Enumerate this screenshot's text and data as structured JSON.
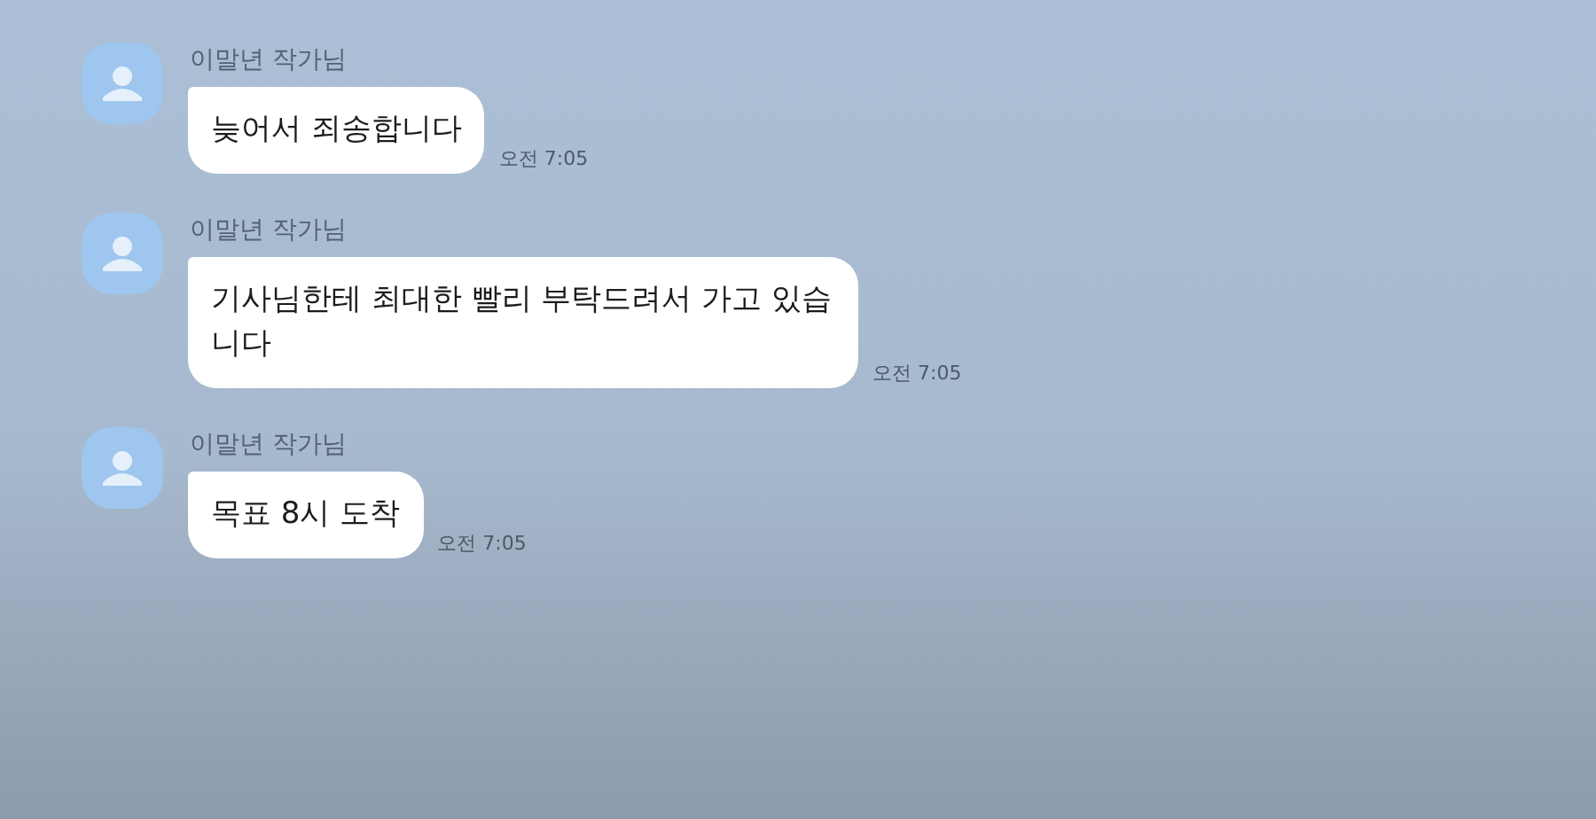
{
  "messages": [
    {
      "sender": "이말년 작가님",
      "text": "늦어서 죄송합니다",
      "time": "오전 7:05"
    },
    {
      "sender": "이말년 작가님",
      "text": "기사님한테 최대한 빨리 부탁드려서 가고 있습니다",
      "time": "오전 7:05"
    },
    {
      "sender": "이말년 작가님",
      "text": "목표 8시 도착",
      "time": "오전 7:05"
    }
  ]
}
